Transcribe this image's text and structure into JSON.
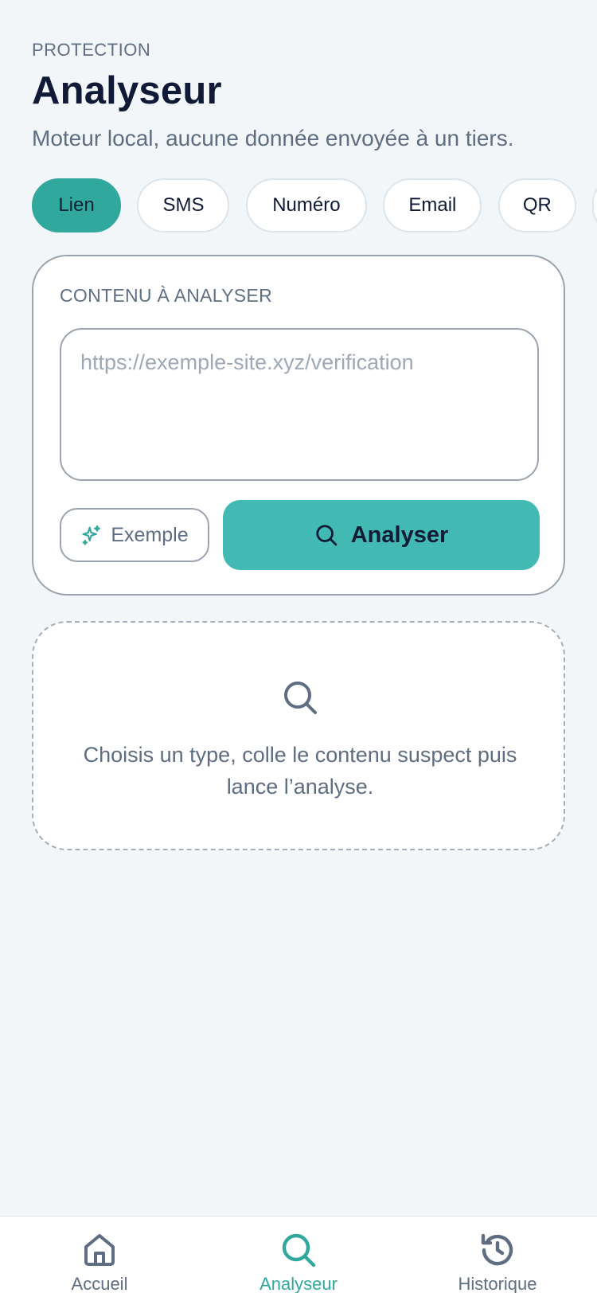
{
  "header": {
    "eyebrow": "PROTECTION",
    "title": "Analyseur",
    "subtitle": "Moteur local, aucune donnée envoyée à un tiers."
  },
  "types": {
    "selected": "Lien",
    "items": [
      {
        "label": "Lien"
      },
      {
        "label": "SMS"
      },
      {
        "label": "Numéro"
      },
      {
        "label": "Email"
      },
      {
        "label": "QR"
      }
    ]
  },
  "input_card": {
    "label": "CONTENU À ANALYSER",
    "value": "",
    "placeholder": "https://exemple-site.xyz/verification",
    "example_button": "Exemple",
    "analyze_button": "Analyser"
  },
  "empty_state": {
    "icon": "search-icon",
    "message": "Choisis un type, colle le contenu suspect puis lance l’analyse."
  },
  "bottom_nav": {
    "active": "Analyseur",
    "items": [
      {
        "label": "Accueil",
        "icon": "home-icon"
      },
      {
        "label": "Analyseur",
        "icon": "search-icon"
      },
      {
        "label": "Historique",
        "icon": "history-icon"
      }
    ]
  },
  "colors": {
    "accent": "#30a89d",
    "accent_button": "#42bab3",
    "background": "#f2f6f9",
    "text_primary": "#101a36",
    "text_secondary": "#5e6d82"
  }
}
